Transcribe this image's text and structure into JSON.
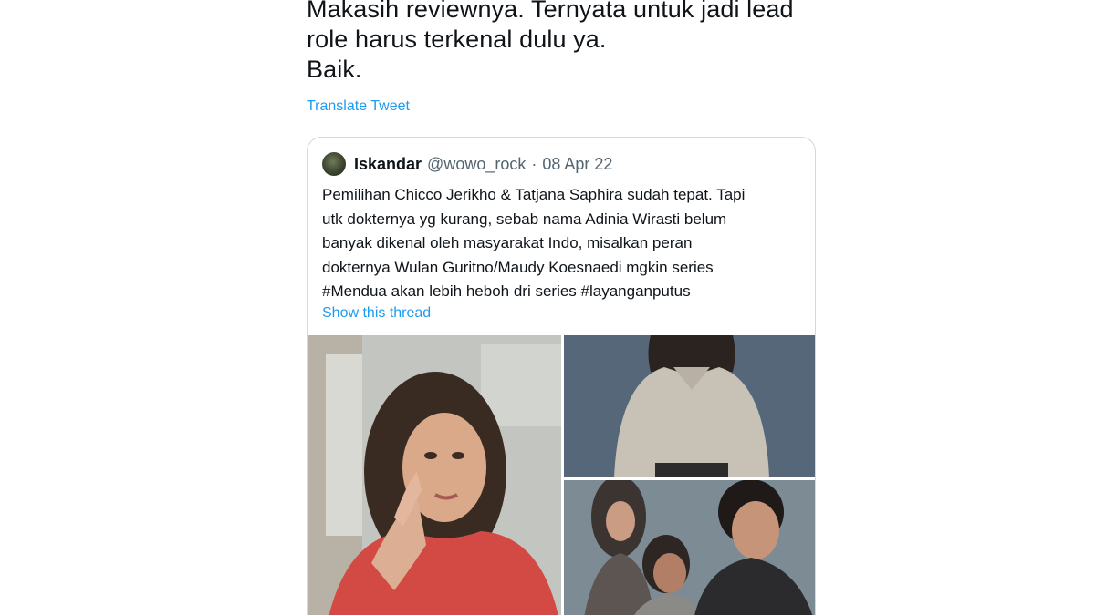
{
  "tweet": {
    "text_lines": [
      "Makasih reviewnya. Ternyata untuk jadi lead",
      "role harus terkenal dulu ya.",
      "Baik."
    ],
    "translate_label": "Translate Tweet"
  },
  "quoted_tweet": {
    "author_name": "Iskandar",
    "author_handle": "@wowo_rock",
    "separator": "·",
    "date": "08 Apr 22",
    "body_lines": [
      "Pemilihan Chicco Jerikho & Tatjana Saphira sudah tepat. Tapi",
      "utk dokternya yg kurang, sebab nama Adinia Wirasti belum",
      "banyak dikenal oleh masyarakat Indo, misalkan peran",
      "dokternya Wulan Guritno/Maudy Koesnaedi mgkin series",
      "#Mendua akan lebih heboh dri series #layanganputus"
    ],
    "show_thread_label": "Show this thread"
  },
  "colors": {
    "link": "#1d9bf0",
    "text": "#0f1419",
    "secondary_text": "#536471",
    "border": "#cfd9de"
  }
}
